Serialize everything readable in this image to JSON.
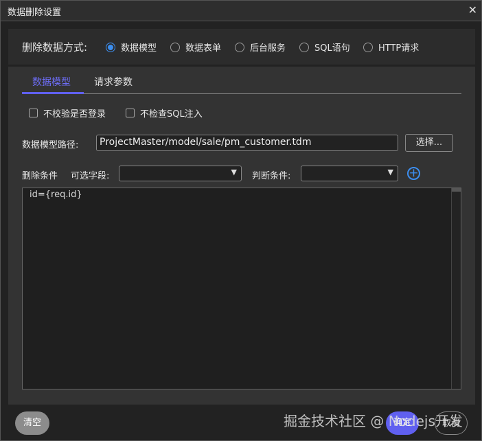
{
  "dialog": {
    "title": "数据删除设置",
    "close": "✕"
  },
  "method": {
    "label": "删除数据方式:",
    "options": [
      "数据模型",
      "数据表单",
      "后台服务",
      "SQL语句",
      "HTTP请求"
    ],
    "selected": "数据模型"
  },
  "tabs": [
    "数据模型",
    "请求参数"
  ],
  "checks": [
    "不校验是否登录",
    "不检查SQL注入"
  ],
  "model_path": {
    "label": "数据模型路径:",
    "value": "ProjectMaster/model/sale/pm_customer.tdm",
    "button": "选择..."
  },
  "conditions": {
    "label": "删除条件",
    "field_label": "可选字段:",
    "judge_label": "判断条件:",
    "add": "+"
  },
  "editor": {
    "text": "id={req.id}"
  },
  "footer": {
    "clear": "清空",
    "ok": "确定",
    "cancel": "取消"
  },
  "watermark": "掘金技术社区 @ Nodejs开发",
  "colors": {
    "accent": "#6060f0",
    "radio": "#3c8ef0"
  }
}
